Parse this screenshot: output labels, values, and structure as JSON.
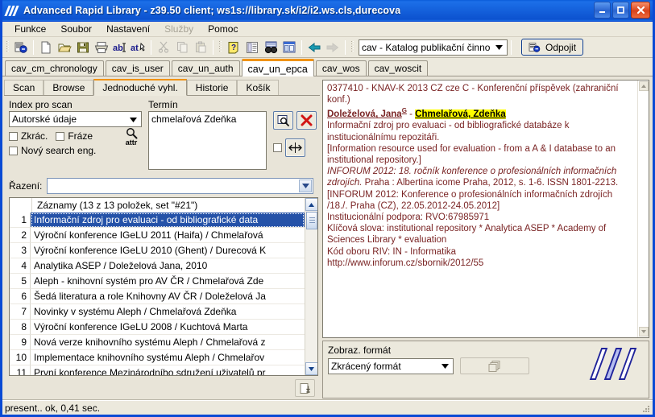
{
  "window": {
    "title": "Advanced Rapid Library - z39.50 client; ws1s://library.sk/i2/i2.ws.cls,durecova",
    "icon": "app-logo-icon",
    "minimize_label": "Minimize",
    "maximize_label": "Maximize",
    "close_label": "Close"
  },
  "menubar": {
    "items": [
      {
        "label": "Funkce",
        "disabled": false
      },
      {
        "label": "Soubor",
        "disabled": false
      },
      {
        "label": "Nastavení",
        "disabled": false
      },
      {
        "label": "Služby",
        "disabled": true
      },
      {
        "label": "Pomoc",
        "disabled": false
      }
    ]
  },
  "toolbar": {
    "buttons": [
      {
        "name": "connect-icon",
        "disabled": false
      },
      {
        "name": "new-document-icon",
        "disabled": false
      },
      {
        "name": "open-folder-icon",
        "disabled": false
      },
      {
        "name": "save-disk-icon",
        "disabled": false
      },
      {
        "name": "print-icon",
        "disabled": false
      },
      {
        "name": "abi-text-icon",
        "disabled": false
      },
      {
        "name": "att-text-icon",
        "disabled": false
      },
      {
        "name": "cut-scissors-icon",
        "disabled": true
      },
      {
        "name": "copy-icon",
        "disabled": true
      },
      {
        "name": "paste-icon",
        "disabled": true
      },
      {
        "name": "help-question-icon",
        "disabled": false
      },
      {
        "name": "record-view-icon",
        "disabled": false
      },
      {
        "name": "find-binoculars-icon",
        "disabled": false
      },
      {
        "name": "window-layout-icon",
        "disabled": false
      },
      {
        "name": "back-arrow-icon",
        "disabled": false
      },
      {
        "name": "forward-arrow-icon",
        "disabled": true
      }
    ],
    "database_combo": {
      "value": "cav - Katalog publikační činno",
      "options": [
        "cav - Katalog publikační činno"
      ]
    },
    "disconnect_label": "Odpojit"
  },
  "db_tabs": {
    "items": [
      {
        "label": "cav_cm_chronology",
        "active": false
      },
      {
        "label": "cav_is_user",
        "active": false
      },
      {
        "label": "cav_un_auth",
        "active": false
      },
      {
        "label": "cav_un_epca",
        "active": true
      },
      {
        "label": "cav_wos",
        "active": false
      },
      {
        "label": "cav_woscit",
        "active": false
      }
    ],
    "active_accent": "#f09316"
  },
  "search": {
    "tabs": [
      {
        "label": "Scan",
        "active": false
      },
      {
        "label": "Browse",
        "active": false
      },
      {
        "label": "Jednoduché vyhl.",
        "active": true
      },
      {
        "label": "Historie",
        "active": false
      },
      {
        "label": "Košík",
        "active": false
      }
    ],
    "index_label": "Index pro scan",
    "index_combo": {
      "value": "Autorské údaje"
    },
    "checkboxes": [
      {
        "label": "Zkrác.",
        "checked": false
      },
      {
        "label": "Fráze",
        "checked": false
      },
      {
        "label": "Nový search eng.",
        "checked": false
      }
    ],
    "attr_button_label": "attr",
    "term_label": "Termín",
    "term_value": "chmelařová Zdeňka",
    "search_button": "search-magnifier-icon",
    "clear_button": "clear-x-icon",
    "expand_checkbox": {
      "checked": false
    },
    "expand_button": "resize-horizontal-icon",
    "sort_label": "Řazení:",
    "sort_value": ""
  },
  "results": {
    "header": "Záznamy (13 z 13 položek, set \"#21\")",
    "rows": [
      {
        "num": "1",
        "title": "Informační zdroj pro evaluaci - od bibliografické data",
        "selected": true
      },
      {
        "num": "2",
        "title": "Výroční konference IGeLU 2011 (Haifa) / Chmelařová",
        "selected": false
      },
      {
        "num": "3",
        "title": "Výroční konference IGeLU 2010 (Ghent) / Durecová K",
        "selected": false
      },
      {
        "num": "4",
        "title": "Analytika ASEP / Doleželová Jana, 2010",
        "selected": false
      },
      {
        "num": "5",
        "title": "Aleph - knihovní systém pro AV ČR / Chmelařová Zde",
        "selected": false
      },
      {
        "num": "6",
        "title": "Šedá literatura a role Knihovny AV ČR / Doleželová Ja",
        "selected": false
      },
      {
        "num": "7",
        "title": "Novinky v systému Aleph / Chmelařová Zdeňka",
        "selected": false
      },
      {
        "num": "8",
        "title": "Výroční konference IGeLU 2008 / Kuchtová Marta",
        "selected": false
      },
      {
        "num": "9",
        "title": "Nová verze knihovního systému Aleph / Chmelařová z",
        "selected": false
      },
      {
        "num": "10",
        "title": "Implementace knihovního systému Aleph / Chmelařov",
        "selected": false
      },
      {
        "num": "11",
        "title": "První konference Mezinárodního sdružení uživatelů pr",
        "selected": false
      }
    ],
    "save_button": "save-to-disk-icon"
  },
  "detail": {
    "line1": "0377410 - KNAV-K 2013 CZ cze C - Konferenční příspěvek (zahraniční konf.)",
    "author1": "Doleželová, Jana",
    "author1_sup": "G",
    "author_sep": " - ",
    "author2_highlighted": "Chmelařová, Zdeňka",
    "title_cz": "Informační zdroj pro evaluaci - od bibliografické databáze k institucionálnímu repozitáři.",
    "title_en": "[Information resource used for evaluation - from a A & I database to an institutional repository.]",
    "source_italic": "INFORUM 2012: 18. ročník konference o profesionálních informačních zdrojích.",
    "source_rest": " Praha : Albertina icome Praha, 2012, s. 1-6. ISSN 1801-2213.",
    "conference": "[INFORUM 2012: Konference o profesionálních informačních zdrojích /18./. Praha (CZ), 22.05.2012-24.05.2012]",
    "support": "Institucionální podpora: RVO:67985971",
    "keywords": "Klíčová slova: institutional repository * Analytica ASEP * Academy of Sciences Library * evaluation",
    "riv_code": "Kód oboru RIV: IN - Informatika",
    "url": "http://www.inforum.cz/sbornik/2012/55",
    "text_color": "#7a2424",
    "highlight_color": "#ffff00"
  },
  "format_panel": {
    "label": "Zobraz. formát",
    "combo_value": "Zkrácený formát",
    "copy_button": "copy-records-icon",
    "logo": "arl-logo-icon"
  },
  "statusbar": {
    "text": "present.. ok, 0,41 sec."
  }
}
